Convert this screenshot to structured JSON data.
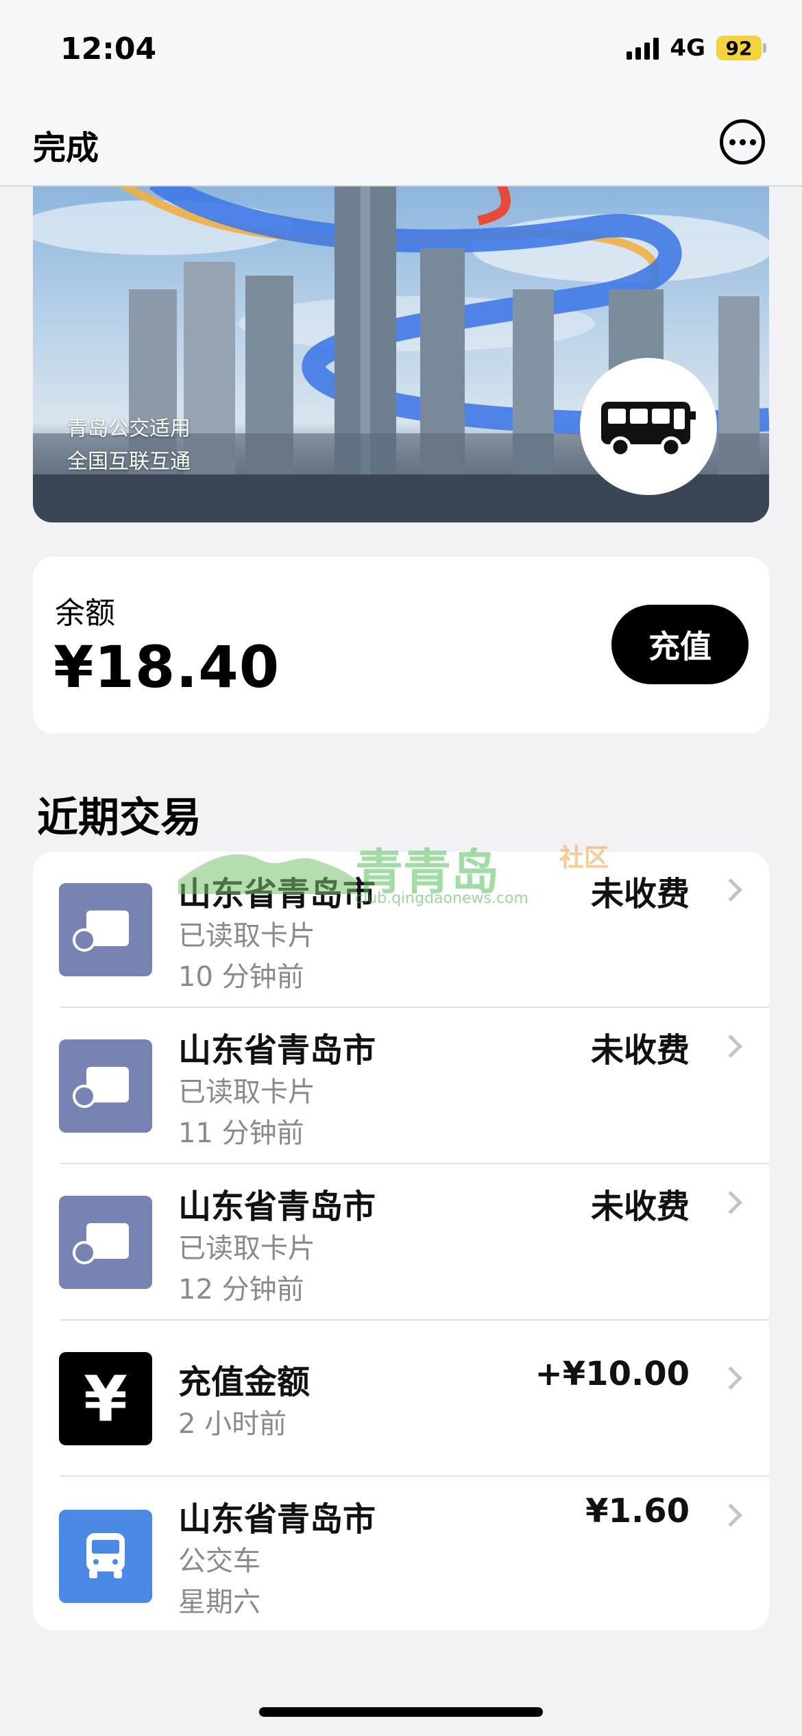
{
  "status_bar": {
    "time": "12:04",
    "network": "4G",
    "battery": "92"
  },
  "nav": {
    "done_label": "完成",
    "more_icon": "ellipsis-circle-icon"
  },
  "card": {
    "caption_line1": "青岛公交适用",
    "caption_line2": "全国互联互通",
    "badge_icon": "bus-icon"
  },
  "balance": {
    "label": "余额",
    "value": "¥18.40",
    "recharge_label": "充值"
  },
  "transactions": {
    "title": "近期交易",
    "items": [
      {
        "icon": "card-read-icon",
        "title": "山东省青岛市",
        "sub1": "已读取卡片",
        "sub2": "10 分钟前",
        "amount": "未收费"
      },
      {
        "icon": "card-read-icon",
        "title": "山东省青岛市",
        "sub1": "已读取卡片",
        "sub2": "11 分钟前",
        "amount": "未收费"
      },
      {
        "icon": "card-read-icon",
        "title": "山东省青岛市",
        "sub1": "已读取卡片",
        "sub2": "12 分钟前",
        "amount": "未收费"
      },
      {
        "icon": "yen-icon",
        "icon_text": "¥",
        "title": "充值金额",
        "sub1": "2 小时前",
        "amount": "+¥10.00"
      },
      {
        "icon": "bus-icon",
        "title": "山东省青岛市",
        "sub1": "公交车",
        "sub2": "星期六",
        "amount": "¥1.60"
      }
    ]
  },
  "watermark": {
    "name": "青青岛",
    "tag": "社区",
    "url": "club.qingdaonews.com"
  },
  "colors": {
    "card_icon_bg": "#7683b3",
    "bus_icon_bg": "#4a8ae6",
    "background": "#f2f2f6"
  }
}
